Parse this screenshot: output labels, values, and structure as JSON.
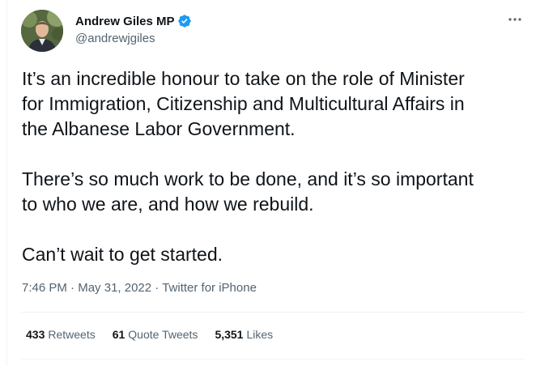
{
  "author": {
    "display_name": "Andrew Giles MP",
    "handle": "@andrewjgiles",
    "verified": true,
    "avatar_icon": "profile-photo"
  },
  "tweet": {
    "lines_p1": [
      "It’s an incredible honour to take on the role of Minister",
      "for Immigration, Citizenship and Multicultural Affairs in",
      "the Albanese Labor Government."
    ],
    "lines_p2": [
      "There’s so much work to be done, and it’s so important",
      "to who we are, and how we rebuild."
    ],
    "lines_p3": [
      "Can’t wait to get started."
    ]
  },
  "meta": {
    "time": "7:46 PM",
    "separator": "·",
    "date": "May 31, 2022",
    "source": "Twitter for iPhone"
  },
  "stats": {
    "retweets_count": "433",
    "retweets_label": "Retweets",
    "quotes_count": "61",
    "quotes_label": "Quote Tweets",
    "likes_count": "5,351",
    "likes_label": "Likes"
  },
  "colors": {
    "text": "#0f1419",
    "secondary": "#536471",
    "verified": "#1d9bf0",
    "divider": "#eff3f4"
  }
}
